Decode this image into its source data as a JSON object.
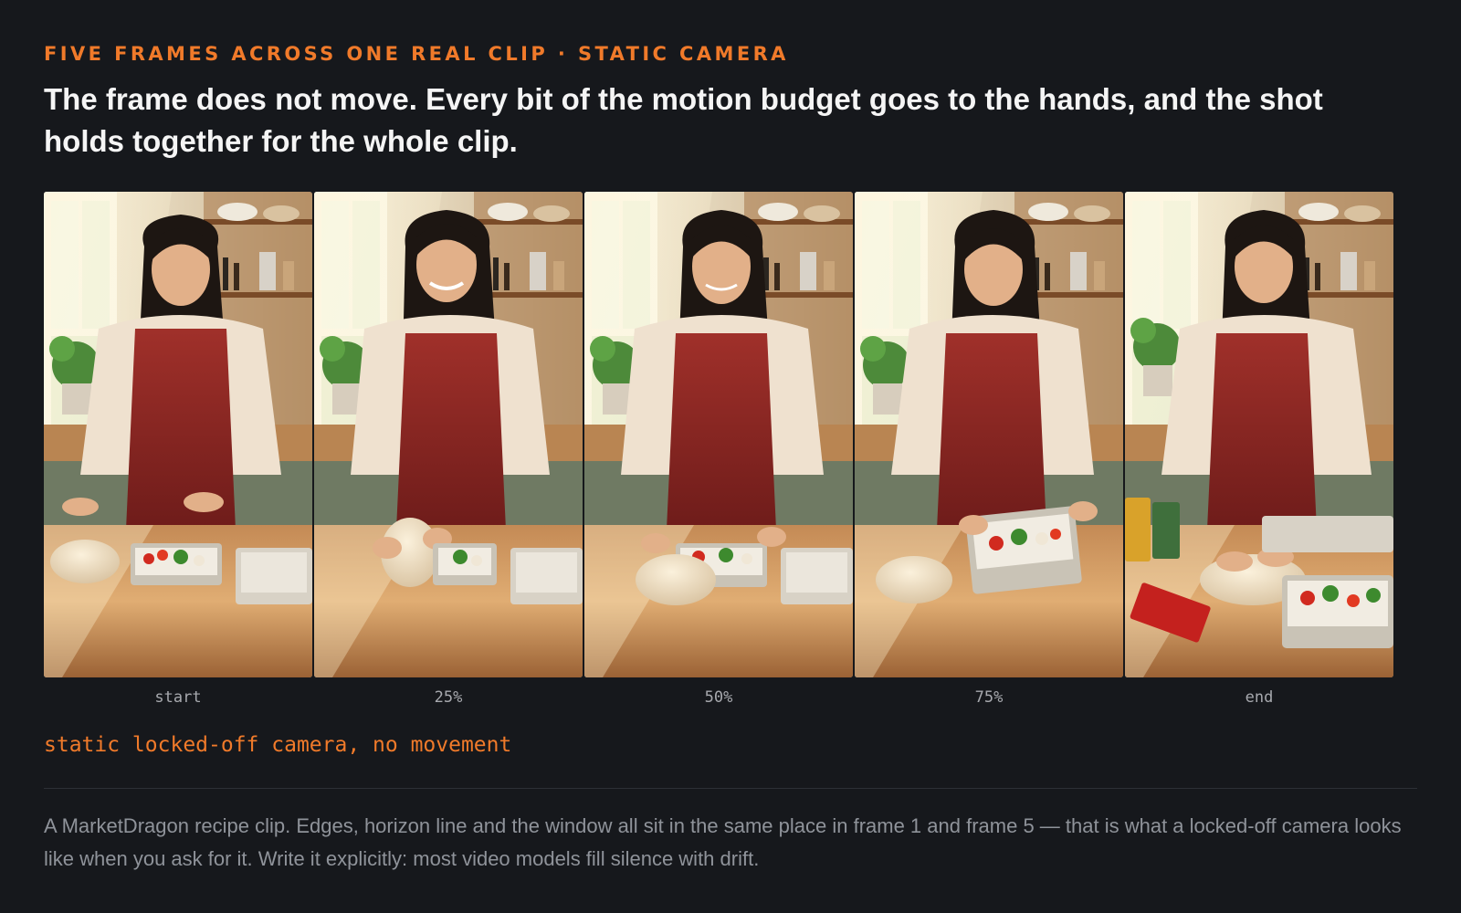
{
  "eyebrow": "FIVE FRAMES ACROSS ONE REAL CLIP · STATIC CAMERA",
  "headline": "The frame does not move. Every bit of the motion budget goes to the hands, and the shot holds together for the whole clip.",
  "frames": [
    {
      "caption": "start"
    },
    {
      "caption": "25%"
    },
    {
      "caption": "50%"
    },
    {
      "caption": "75%"
    },
    {
      "caption": "end"
    }
  ],
  "prompt": "static locked-off camera, no movement",
  "description": "A MarketDragon recipe clip. Edges, horizon line and the window all sit in the same place in frame 1 and frame 5 — that is what a locked-off camera looks like when you ask for it. Write it explicitly: most video models fill silence with drift.",
  "colors": {
    "background": "#16181c",
    "accent": "#f07a2a",
    "headline": "#f5f5f5",
    "muted": "#8f939a"
  }
}
